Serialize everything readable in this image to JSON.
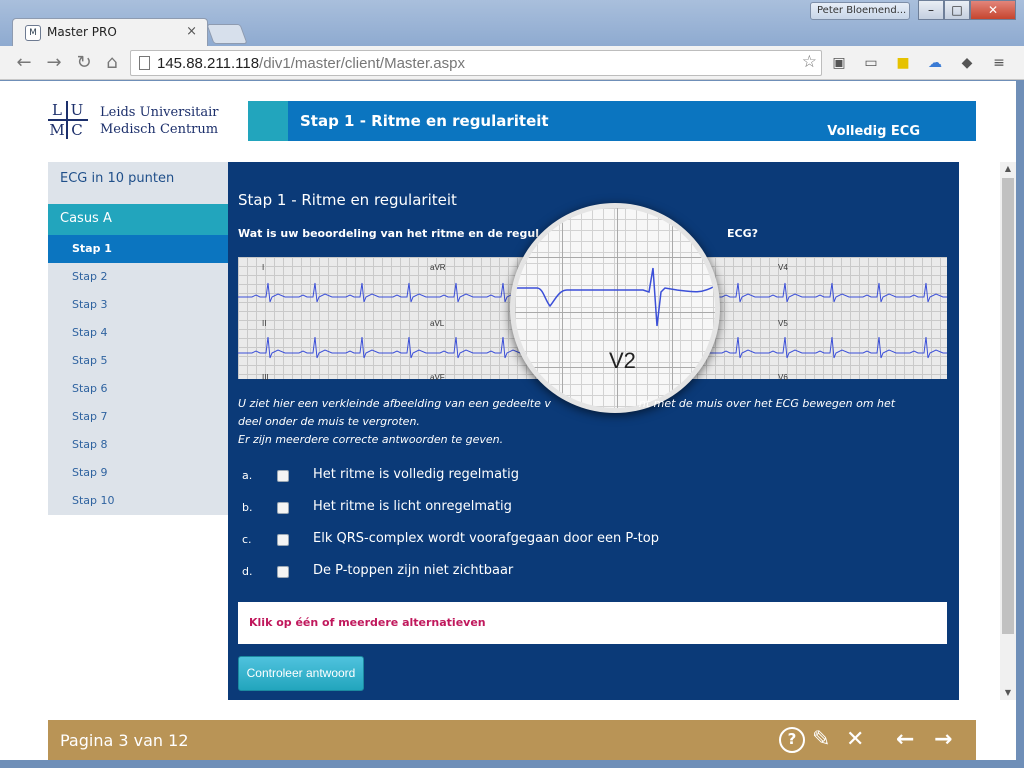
{
  "window": {
    "tab_title": "Master PRO",
    "tab_close": "×",
    "profile_name": "Peter Bloemend...",
    "controls": {
      "minimize": "–",
      "maximize": "□",
      "close": "✕"
    }
  },
  "browser": {
    "url_host": "145.88.211.118",
    "url_path": "/div1/master/client/Master.aspx",
    "icons": [
      "back-icon",
      "forward-icon",
      "reload-icon",
      "home-icon",
      "bookmark-star-icon",
      "menu-icon"
    ]
  },
  "logo": {
    "letters": [
      "L",
      "U",
      "M",
      "C"
    ],
    "line1": "Leids Universitair",
    "line2": "Medisch Centrum"
  },
  "header": {
    "title": "Stap 1 - Ritme en regulariteit",
    "subtitle": "Volledig ECG"
  },
  "sidebar": {
    "top_item": "ECG in 10 punten",
    "section": "Casus A",
    "steps": [
      "Stap 1",
      "Stap 2",
      "Stap 3",
      "Stap 4",
      "Stap 5",
      "Stap 6",
      "Stap 7",
      "Stap 8",
      "Stap 9",
      "Stap 10"
    ],
    "active_index": 0
  },
  "main": {
    "title": "Stap 1 - Ritme en regulariteit",
    "question_left": "Wat is uw beoordeling van het ritme en de regul",
    "question_right": "ECG?",
    "ecg_leads": [
      "I",
      "aVR",
      "V4",
      "II",
      "aVL",
      "V5",
      "III",
      "aVF",
      "V6"
    ],
    "magnifier_label": "V2",
    "info_line1_left": "U ziet hier een verkleinde afbeelding van een gedeelte v",
    "info_line1_right": "nt met de muis over het ECG bewegen om het",
    "info_line2": "deel onder de muis te vergroten.",
    "info_line3": "Er zijn meerdere correcte antwoorden te geven.",
    "options": [
      {
        "letter": "a.",
        "label": "Het ritme is volledig regelmatig",
        "checked": false
      },
      {
        "letter": "b.",
        "label": "Het ritme is licht onregelmatig",
        "checked": false
      },
      {
        "letter": "c.",
        "label": "Elk QRS-complex wordt voorafgegaan door een P-top",
        "checked": false
      },
      {
        "letter": "d.",
        "label": "De P-toppen zijn niet zichtbaar",
        "checked": false
      }
    ],
    "feedback": "Klik op één of meerdere alternatieven",
    "check_button": "Controleer antwoord"
  },
  "footer": {
    "pagination": "Pagina 3 van 12",
    "icons": [
      "help-icon",
      "notes-icon",
      "close-icon",
      "previous-arrow-icon",
      "next-arrow-icon"
    ]
  },
  "colors": {
    "header_blue": "#0b75c0",
    "teal": "#22a5bd",
    "main_navy": "#0b3a78",
    "footer_gold": "#b99456",
    "feedback_red": "#c0185c"
  }
}
